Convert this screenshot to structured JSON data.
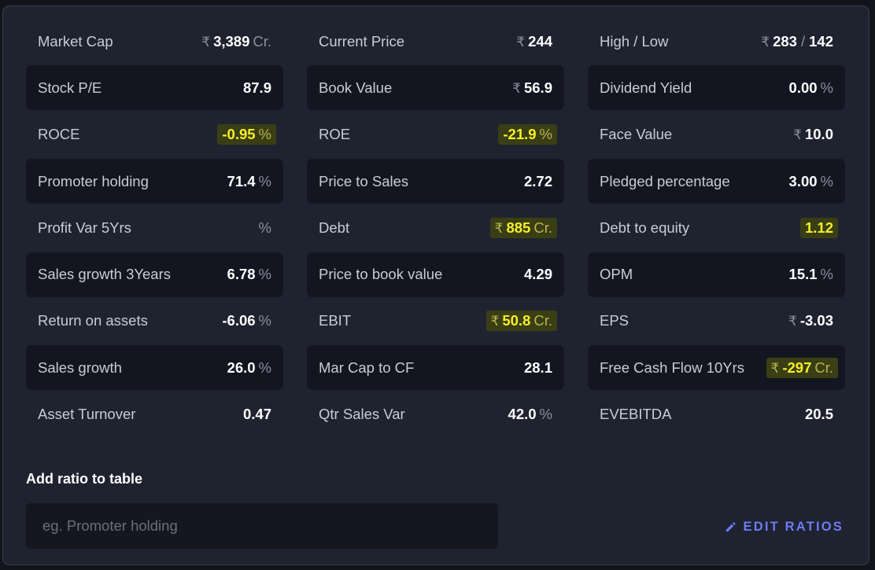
{
  "ratios": [
    {
      "name": "Market Cap",
      "currency": "₹",
      "value": "3,389",
      "unit": "Cr.",
      "highlight": false
    },
    {
      "name": "Current Price",
      "currency": "₹",
      "value": "244",
      "unit": "",
      "highlight": false
    },
    {
      "name": "High / Low",
      "currency": "₹",
      "value": "283",
      "value2": "142",
      "separator": "/",
      "unit": "",
      "highlight": false
    },
    {
      "name": "Stock P/E",
      "currency": "",
      "value": "87.9",
      "unit": "",
      "highlight": false
    },
    {
      "name": "Book Value",
      "currency": "₹",
      "value": "56.9",
      "unit": "",
      "highlight": false
    },
    {
      "name": "Dividend Yield",
      "currency": "",
      "value": "0.00",
      "unit": "%",
      "highlight": false
    },
    {
      "name": "ROCE",
      "currency": "",
      "value": "-0.95",
      "unit": "%",
      "highlight": true
    },
    {
      "name": "ROE",
      "currency": "",
      "value": "-21.9",
      "unit": "%",
      "highlight": true
    },
    {
      "name": "Face Value",
      "currency": "₹",
      "value": "10.0",
      "unit": "",
      "highlight": false
    },
    {
      "name": "Promoter holding",
      "currency": "",
      "value": "71.4",
      "unit": "%",
      "highlight": false
    },
    {
      "name": "Price to Sales",
      "currency": "",
      "value": "2.72",
      "unit": "",
      "highlight": false
    },
    {
      "name": "Pledged percentage",
      "currency": "",
      "value": "3.00",
      "unit": "%",
      "highlight": false
    },
    {
      "name": "Profit Var 5Yrs",
      "currency": "",
      "value": "",
      "unit": "%",
      "highlight": false
    },
    {
      "name": "Debt",
      "currency": "₹",
      "value": "885",
      "unit": "Cr.",
      "highlight": true
    },
    {
      "name": "Debt to equity",
      "currency": "",
      "value": "1.12",
      "unit": "",
      "highlight": true
    },
    {
      "name": "Sales growth 3Years",
      "currency": "",
      "value": "6.78",
      "unit": "%",
      "highlight": false
    },
    {
      "name": "Price to book value",
      "currency": "",
      "value": "4.29",
      "unit": "",
      "highlight": false
    },
    {
      "name": "OPM",
      "currency": "",
      "value": "15.1",
      "unit": "%",
      "highlight": false
    },
    {
      "name": "Return on assets",
      "currency": "",
      "value": "-6.06",
      "unit": "%",
      "highlight": false
    },
    {
      "name": "EBIT",
      "currency": "₹",
      "value": "50.8",
      "unit": "Cr.",
      "highlight": true
    },
    {
      "name": "EPS",
      "currency": "₹",
      "value": "-3.03",
      "unit": "",
      "highlight": false
    },
    {
      "name": "Sales growth",
      "currency": "",
      "value": "26.0",
      "unit": "%",
      "highlight": false
    },
    {
      "name": "Mar Cap to CF",
      "currency": "",
      "value": "28.1",
      "unit": "",
      "highlight": false
    },
    {
      "name": "Free Cash Flow 10Yrs",
      "currency": "₹",
      "value": "-297",
      "unit": "Cr.",
      "highlight": true
    },
    {
      "name": "Asset Turnover",
      "currency": "",
      "value": "0.47",
      "unit": "",
      "highlight": false
    },
    {
      "name": "Qtr Sales Var",
      "currency": "",
      "value": "42.0",
      "unit": "%",
      "highlight": false
    },
    {
      "name": "EVEBITDA",
      "currency": "",
      "value": "20.5",
      "unit": "",
      "highlight": false
    }
  ],
  "add_ratio": {
    "label": "Add ratio to table",
    "placeholder": "eg. Promoter holding"
  },
  "edit_ratios": {
    "label": "EDIT RATIOS",
    "icon": "pencil-icon"
  },
  "colors": {
    "panel_bg": "#1f2330",
    "row_bg": "#131620",
    "highlight_bg": "#3a3e14",
    "highlight_text": "#f4ef2a",
    "accent": "#6c7bf5"
  }
}
